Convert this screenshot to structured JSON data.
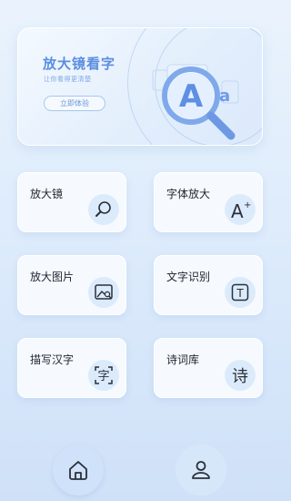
{
  "banner": {
    "title": "放大镜看字",
    "subtitle": "让你看得更清楚",
    "button_label": "立即体验",
    "art_letter": "A"
  },
  "features": [
    {
      "label": "放大镜",
      "icon": "magnifier-icon"
    },
    {
      "label": "字体放大",
      "icon": "font-enlarge-icon"
    },
    {
      "label": "放大图片",
      "icon": "image-zoom-icon"
    },
    {
      "label": "文字识别",
      "icon": "text-recognition-icon"
    },
    {
      "label": "描写汉字",
      "icon": "trace-character-icon"
    },
    {
      "label": "诗词库",
      "icon": "poetry-library-icon"
    }
  ],
  "icon_glyphs": {
    "font_enlarge": "A",
    "font_plus": "+",
    "text_recognition": "T",
    "trace_character": "字",
    "poetry": "诗"
  },
  "nav": [
    {
      "name": "home",
      "icon": "home-icon"
    },
    {
      "name": "profile",
      "icon": "user-icon"
    }
  ],
  "colors": {
    "accent": "#5b8ee0",
    "background": "#dbeafb",
    "card": "#f6fafe",
    "icon_circle": "#dcebfb"
  }
}
